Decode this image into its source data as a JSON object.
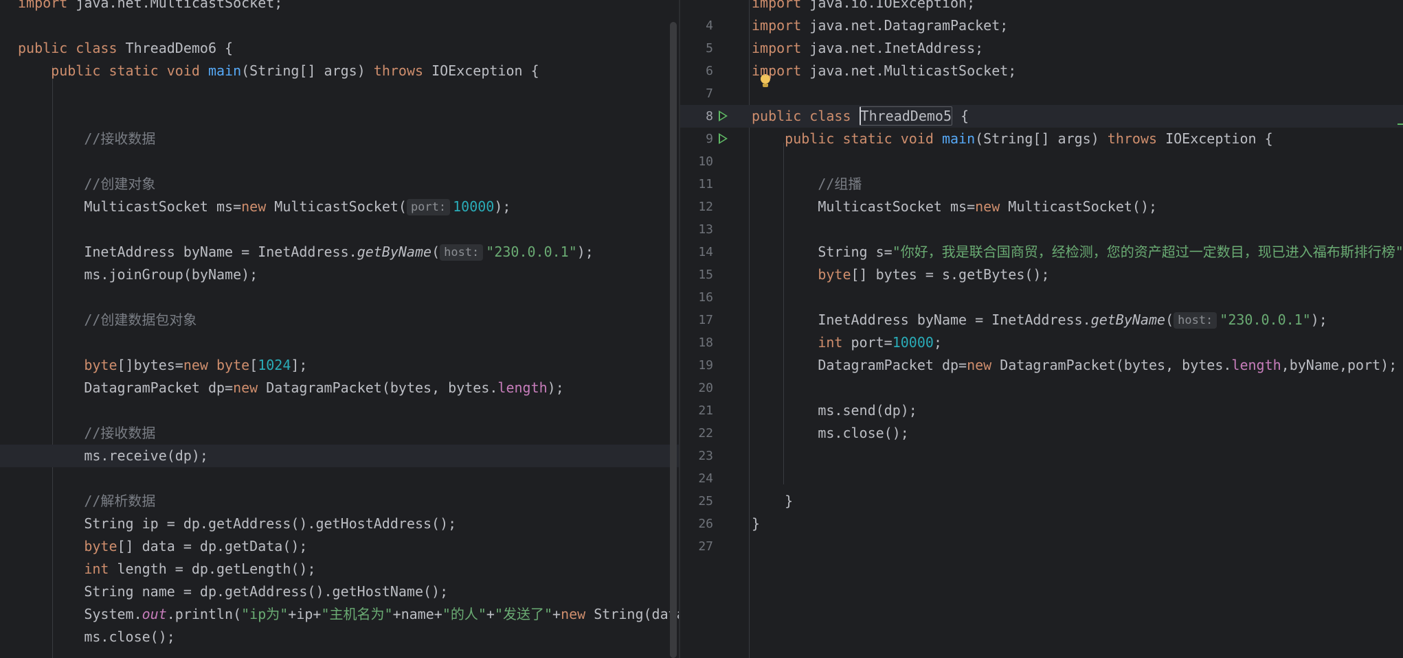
{
  "left_editor": {
    "lines": [
      [
        {
          "t": "import",
          "c": "kw"
        },
        {
          "t": " java.net.MulticastSocket;"
        }
      ],
      [],
      [
        {
          "t": "public class ",
          "c": "kw"
        },
        {
          "t": "ThreadDemo6 {"
        }
      ],
      [
        {
          "t": "    "
        },
        {
          "t": "public static void ",
          "c": "kw"
        },
        {
          "t": "main",
          "c": "fn"
        },
        {
          "t": "(String[] args) "
        },
        {
          "t": "throws ",
          "c": "kw"
        },
        {
          "t": "IOException {"
        }
      ],
      [],
      [],
      [
        {
          "t": "        "
        },
        {
          "t": "//接收数据",
          "c": "cmt"
        }
      ],
      [],
      [
        {
          "t": "        "
        },
        {
          "t": "//创建对象",
          "c": "cmt"
        }
      ],
      [
        {
          "t": "        MulticastSocket ms="
        },
        {
          "t": "new ",
          "c": "kw"
        },
        {
          "t": "MulticastSocket("
        },
        {
          "t": "port:",
          "c": "hint"
        },
        {
          "t": "10000",
          "c": "num"
        },
        {
          "t": ");"
        }
      ],
      [],
      [
        {
          "t": "        InetAddress byName = InetAddress."
        },
        {
          "t": "getByName",
          "c": "ital"
        },
        {
          "t": "("
        },
        {
          "t": "host:",
          "c": "hint"
        },
        {
          "t": "\"230.0.0.1\"",
          "c": "str"
        },
        {
          "t": ");"
        }
      ],
      [
        {
          "t": "        ms.joinGroup(byName);"
        }
      ],
      [],
      [
        {
          "t": "        "
        },
        {
          "t": "//创建数据包对象",
          "c": "cmt"
        }
      ],
      [],
      [
        {
          "t": "        "
        },
        {
          "t": "byte",
          "c": "kw"
        },
        {
          "t": "[]bytes="
        },
        {
          "t": "new ",
          "c": "kw"
        },
        {
          "t": "byte",
          "c": "kw"
        },
        {
          "t": "["
        },
        {
          "t": "1024",
          "c": "num"
        },
        {
          "t": "];"
        }
      ],
      [
        {
          "t": "        DatagramPacket dp="
        },
        {
          "t": "new ",
          "c": "kw"
        },
        {
          "t": "DatagramPacket(bytes, bytes."
        },
        {
          "t": "length",
          "c": "fld"
        },
        {
          "t": ");"
        }
      ],
      [],
      [
        {
          "t": "        "
        },
        {
          "t": "//接收数据",
          "c": "cmt"
        }
      ],
      [
        {
          "t": "        ms.receive(dp);"
        }
      ],
      [],
      [
        {
          "t": "        "
        },
        {
          "t": "//解析数据",
          "c": "cmt"
        }
      ],
      [
        {
          "t": "        String ip = dp.getAddress().getHostAddress();"
        }
      ],
      [
        {
          "t": "        "
        },
        {
          "t": "byte",
          "c": "kw"
        },
        {
          "t": "[] data = dp.getData();"
        }
      ],
      [
        {
          "t": "        "
        },
        {
          "t": "int ",
          "c": "kw"
        },
        {
          "t": "length = dp.getLength();"
        }
      ],
      [
        {
          "t": "        String name = dp.getAddress().getHostName();"
        }
      ],
      [
        {
          "t": "        System."
        },
        {
          "t": "out",
          "c": "static-fld"
        },
        {
          "t": ".println("
        },
        {
          "t": "\"ip为\"",
          "c": "str"
        },
        {
          "t": "+ip+"
        },
        {
          "t": "\"主机名为\"",
          "c": "str"
        },
        {
          "t": "+name+"
        },
        {
          "t": "\"的人\"",
          "c": "str"
        },
        {
          "t": "+"
        },
        {
          "t": "\"发送了\"",
          "c": "str"
        },
        {
          "t": "+"
        },
        {
          "t": "new ",
          "c": "kw"
        },
        {
          "t": "String(data"
        }
      ],
      [
        {
          "t": "        ms.close();"
        }
      ],
      []
    ]
  },
  "right_editor": {
    "lines": [
      {
        "n": "",
        "seg": [
          {
            "t": "import",
            "c": "kw"
          },
          {
            "t": " java.io.IOException;"
          }
        ]
      },
      {
        "n": "4",
        "seg": [
          {
            "t": "import ",
            "c": "kw"
          },
          {
            "t": "java.net.DatagramPacket;"
          }
        ]
      },
      {
        "n": "5",
        "seg": [
          {
            "t": "import ",
            "c": "kw"
          },
          {
            "t": "java.net.InetAddress;"
          }
        ]
      },
      {
        "n": "6",
        "seg": [
          {
            "t": "import ",
            "c": "kw"
          },
          {
            "t": "java.net.MulticastSocket;"
          }
        ]
      },
      {
        "n": "7",
        "seg": []
      },
      {
        "n": "8",
        "run": true,
        "seg": [
          {
            "t": "public class ",
            "c": "kw"
          },
          {
            "t": "ThreadDemo5",
            "c": "sel"
          },
          {
            "t": " {"
          }
        ]
      },
      {
        "n": "9",
        "run": true,
        "seg": [
          {
            "t": "    "
          },
          {
            "t": "public static void ",
            "c": "kw"
          },
          {
            "t": "main",
            "c": "fn"
          },
          {
            "t": "(String[] args) "
          },
          {
            "t": "throws ",
            "c": "kw"
          },
          {
            "t": "IOException {"
          }
        ]
      },
      {
        "n": "10",
        "seg": []
      },
      {
        "n": "11",
        "seg": [
          {
            "t": "        "
          },
          {
            "t": "//组播",
            "c": "cmt"
          }
        ]
      },
      {
        "n": "12",
        "seg": [
          {
            "t": "        MulticastSocket ms="
          },
          {
            "t": "new ",
            "c": "kw"
          },
          {
            "t": "MulticastSocket();"
          }
        ]
      },
      {
        "n": "13",
        "seg": []
      },
      {
        "n": "14",
        "seg": [
          {
            "t": "        String s="
          },
          {
            "t": "\"你好，我是联合国商贸，经检测，您的资产超过一定数目，现已进入福布斯排行榜\"",
            "c": "str"
          },
          {
            "t": ";"
          }
        ]
      },
      {
        "n": "15",
        "seg": [
          {
            "t": "        "
          },
          {
            "t": "byte",
            "c": "kw"
          },
          {
            "t": "[] bytes = s.getBytes();"
          }
        ]
      },
      {
        "n": "16",
        "seg": []
      },
      {
        "n": "17",
        "seg": [
          {
            "t": "        InetAddress byName = InetAddress."
          },
          {
            "t": "getByName",
            "c": "ital"
          },
          {
            "t": "("
          },
          {
            "t": "host:",
            "c": "hint"
          },
          {
            "t": "\"230.0.0.1\"",
            "c": "str"
          },
          {
            "t": ");"
          }
        ]
      },
      {
        "n": "18",
        "seg": [
          {
            "t": "        "
          },
          {
            "t": "int ",
            "c": "kw"
          },
          {
            "t": "port="
          },
          {
            "t": "10000",
            "c": "num"
          },
          {
            "t": ";"
          }
        ]
      },
      {
        "n": "19",
        "seg": [
          {
            "t": "        DatagramPacket dp="
          },
          {
            "t": "new ",
            "c": "kw"
          },
          {
            "t": "DatagramPacket(bytes, bytes."
          },
          {
            "t": "length",
            "c": "fld"
          },
          {
            "t": ",byName,port);"
          }
        ]
      },
      {
        "n": "20",
        "seg": []
      },
      {
        "n": "21",
        "seg": [
          {
            "t": "        ms.send(dp);"
          }
        ]
      },
      {
        "n": "22",
        "seg": [
          {
            "t": "        ms.close();"
          }
        ]
      },
      {
        "n": "23",
        "seg": []
      },
      {
        "n": "24",
        "seg": []
      },
      {
        "n": "25",
        "seg": [
          {
            "t": "    }"
          }
        ]
      },
      {
        "n": "26",
        "seg": [
          {
            "t": "}"
          }
        ]
      },
      {
        "n": "27",
        "seg": []
      }
    ]
  }
}
